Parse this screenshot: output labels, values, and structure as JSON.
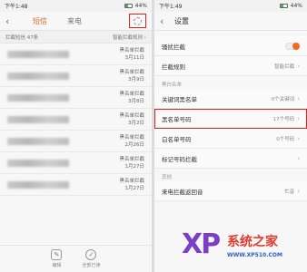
{
  "left": {
    "status_time": "下午1:48",
    "status_right": "44%",
    "tabs": [
      "短信",
      "来电"
    ],
    "intercepted_label": "拦截短信 47条",
    "smart_rules_label": "智能拦截规则",
    "items": [
      {
        "tag": "黑名单拦截",
        "date": "3月11日"
      },
      {
        "tag": "黑名单拦截",
        "date": "3月9日"
      },
      {
        "tag": "黑名单拦截",
        "date": "3月8日"
      },
      {
        "tag": "黑名单拦截",
        "date": "3月2日"
      },
      {
        "tag": "黑名单拦截",
        "date": "2月26日"
      },
      {
        "tag": "黑名单拦截",
        "date": "1月27日"
      },
      {
        "tag": "黑名单拦截",
        "date": "1月27日"
      }
    ],
    "bottom": {
      "edit_label": "编辑",
      "read_all_label": "全部已读"
    }
  },
  "right": {
    "status_time": "下午1:49",
    "status_right": "44%",
    "title": "设置",
    "rows": [
      {
        "label": "骚扰拦截",
        "value": ""
      },
      {
        "label": "拦截规则",
        "value": "智能拦截"
      }
    ],
    "section_blacklist": "黑白名单",
    "blacklist_rows": [
      {
        "label": "关键词黑名单",
        "value": "0个关键词"
      },
      {
        "label": "黑名单号码",
        "value": "17个号码"
      },
      {
        "label": "白名单号码",
        "value": "0个号码"
      },
      {
        "label": "标记号码拦截",
        "value": ""
      }
    ],
    "section_other": "其他",
    "other_rows": [
      {
        "label": "来电拦截返回音",
        "value": "忙音"
      }
    ]
  },
  "watermark": {
    "logo": "XP",
    "site": "系统之家",
    "url": "WWW.XP510.COM"
  },
  "colors": {
    "accent": "#f26b1d",
    "highlight": "#dd2222"
  }
}
